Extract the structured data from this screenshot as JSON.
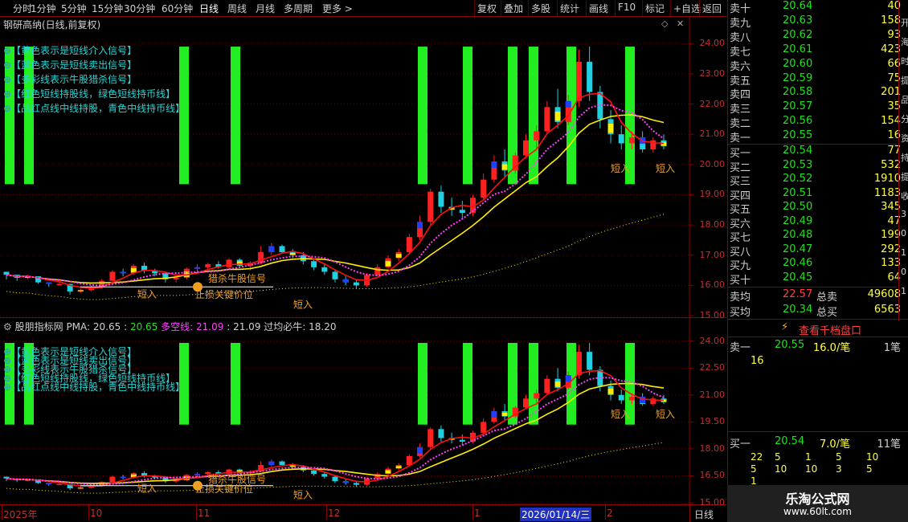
{
  "toolbar": {
    "periods": [
      "分时",
      "1分钟",
      "5分钟",
      "15分钟",
      "30分钟",
      "60分钟",
      "日线",
      "周线",
      "月线",
      "多周期",
      "更多 >"
    ],
    "active_period": "日线",
    "actions": [
      "复权",
      "叠加",
      "多股",
      "统计",
      "画线",
      "F10",
      "标记",
      "+自选",
      "返回"
    ]
  },
  "top_pane": {
    "title": "钢研高纳(日线,前复权)",
    "notes": [
      "【黄色表示是短线介入信号】",
      "【蓝色表示是短线卖出信号】",
      "【多彩线表示牛股猎杀信号】",
      "【红色短线持股线，绿色短线持币线】",
      "【品红点线中线持股，青色中线持币线】"
    ],
    "axis": [
      "24.00",
      "23.00",
      "22.00",
      "21.00",
      "20.00",
      "19.00",
      "18.00",
      "17.00",
      "16.00",
      "15.00"
    ],
    "labels": {
      "duanru1": "短入",
      "duanru2": "短入",
      "duanru3": "短入",
      "duanru4": "短入",
      "signal": "猎杀牛股信号",
      "stop": "止损关键价位"
    }
  },
  "bottom_pane": {
    "title": "股朋指标网",
    "pma_label": "PMA:",
    "pma_value": "20.65",
    "v2": "20.65",
    "duokong_label": "多空线:",
    "duokong_value": "21.09",
    "v4": "21.09",
    "niu_label": "过均必牛:",
    "niu_value": "18.20",
    "axis": [
      "24.00",
      "22.50",
      "21.00",
      "19.50",
      "18.00",
      "16.50",
      "15.00"
    ]
  },
  "xaxis": {
    "labels": [
      "2025年",
      "10",
      "11",
      "12",
      "1",
      "2026/01/14/三",
      "2"
    ],
    "mode": "日线"
  },
  "book": {
    "asks": [
      {
        "lab": "卖十",
        "price": "20.64",
        "vol": "40"
      },
      {
        "lab": "卖九",
        "price": "20.63",
        "vol": "158"
      },
      {
        "lab": "卖八",
        "price": "20.62",
        "vol": "93"
      },
      {
        "lab": "卖七",
        "price": "20.61",
        "vol": "423"
      },
      {
        "lab": "卖六",
        "price": "20.60",
        "vol": "66"
      },
      {
        "lab": "卖五",
        "price": "20.59",
        "vol": "75"
      },
      {
        "lab": "卖四",
        "price": "20.58",
        "vol": "201"
      },
      {
        "lab": "卖三",
        "price": "20.57",
        "vol": "35"
      },
      {
        "lab": "卖二",
        "price": "20.56",
        "vol": "154"
      },
      {
        "lab": "卖一",
        "price": "20.55",
        "vol": "16"
      }
    ],
    "bids": [
      {
        "lab": "买一",
        "price": "20.54",
        "vol": "77"
      },
      {
        "lab": "买二",
        "price": "20.53",
        "vol": "532"
      },
      {
        "lab": "买三",
        "price": "20.52",
        "vol": "1910"
      },
      {
        "lab": "买四",
        "price": "20.51",
        "vol": "1183"
      },
      {
        "lab": "买五",
        "price": "20.50",
        "vol": "345"
      },
      {
        "lab": "买六",
        "price": "20.49",
        "vol": "47"
      },
      {
        "lab": "买七",
        "price": "20.48",
        "vol": "199"
      },
      {
        "lab": "买八",
        "price": "20.47",
        "vol": "292"
      },
      {
        "lab": "买九",
        "price": "20.46",
        "vol": "133"
      },
      {
        "lab": "买十",
        "price": "20.45",
        "vol": "64"
      }
    ],
    "sell_avg_label": "卖均",
    "sell_avg": "22.57",
    "sell_total_label": "总卖",
    "sell_total": "49608",
    "buy_avg_label": "买均",
    "buy_avg": "20.34",
    "buy_total_label": "总买",
    "buy_total": "6563",
    "depth_button": "查看千档盘口",
    "s1_label": "卖一",
    "s1_price": "20.55",
    "s1_per": "16.0/笔",
    "s1_cnt": "1笔",
    "s1_q": "16",
    "b1_label": "买一",
    "b1_price": "20.54",
    "b1_per": "7.0/笔",
    "b1_cnt": "11笔",
    "b1_qrows": [
      [
        "22",
        "5",
        "1",
        "5",
        "10"
      ],
      [
        "5",
        "10",
        "10",
        "3",
        "5"
      ],
      [
        "1",
        "",
        "",
        "",
        ""
      ]
    ],
    "side_text": [
      "开",
      "海",
      "时",
      "提",
      "品",
      "分",
      "资",
      "持",
      "提",
      "收",
      "3",
      "0",
      "1",
      "0",
      "1"
    ]
  },
  "logo": {
    "name": "乐淘公式网",
    "url": "www.60lt.com"
  },
  "chart_data": {
    "type": "candlestick",
    "ylim_top": [
      15,
      24.3
    ],
    "ylim_bottom": [
      15,
      24.3
    ],
    "green_bars_x": [
      12,
      36,
      229,
      293,
      526,
      582,
      638,
      664,
      711,
      784
    ],
    "candles": [
      [
        16.45,
        16.45,
        16.2,
        16.35
      ],
      [
        16.35,
        16.3,
        16.15,
        16.25
      ],
      [
        16.25,
        16.35,
        16.2,
        16.3
      ],
      [
        16.3,
        16.2,
        16.05,
        16.1
      ],
      [
        16.1,
        16.05,
        15.95,
        16.05
      ],
      [
        16.05,
        16.1,
        16.0,
        16.05
      ],
      [
        16.05,
        15.95,
        15.7,
        15.8
      ],
      [
        15.8,
        15.9,
        15.75,
        15.85
      ],
      [
        15.85,
        16.0,
        15.8,
        15.95
      ],
      [
        15.95,
        16.2,
        15.9,
        16.15
      ],
      [
        16.15,
        16.5,
        16.1,
        16.45
      ],
      [
        16.45,
        16.55,
        16.3,
        16.4
      ],
      [
        16.4,
        16.7,
        16.35,
        16.65
      ],
      [
        16.65,
        16.75,
        16.4,
        16.5
      ],
      [
        16.5,
        16.55,
        16.3,
        16.4
      ],
      [
        16.4,
        16.35,
        16.1,
        16.2
      ],
      [
        16.2,
        16.3,
        16.1,
        16.25
      ],
      [
        16.25,
        16.6,
        16.2,
        16.55
      ],
      [
        16.55,
        16.7,
        16.45,
        16.6
      ],
      [
        16.6,
        16.75,
        16.5,
        16.7
      ],
      [
        16.7,
        16.8,
        16.55,
        16.6
      ],
      [
        16.6,
        16.9,
        16.55,
        16.85
      ],
      [
        16.85,
        16.9,
        16.6,
        16.65
      ],
      [
        16.65,
        16.8,
        16.5,
        16.75
      ],
      [
        16.75,
        17.3,
        16.7,
        17.1
      ],
      [
        17.1,
        17.4,
        17.0,
        17.3
      ],
      [
        17.3,
        17.35,
        17.05,
        17.1
      ],
      [
        17.1,
        17.2,
        16.9,
        17.0
      ],
      [
        17.0,
        17.1,
        16.7,
        16.8
      ],
      [
        16.8,
        16.85,
        16.5,
        16.6
      ],
      [
        16.6,
        16.7,
        16.35,
        16.45
      ],
      [
        16.45,
        16.5,
        16.1,
        16.2
      ],
      [
        16.2,
        16.3,
        16.0,
        16.1
      ],
      [
        16.1,
        16.2,
        15.9,
        16.0
      ],
      [
        16.0,
        16.4,
        15.95,
        16.35
      ],
      [
        16.35,
        16.7,
        16.3,
        16.6
      ],
      [
        16.6,
        17.0,
        16.55,
        16.9
      ],
      [
        16.9,
        17.2,
        16.8,
        17.1
      ],
      [
        17.1,
        17.7,
        17.05,
        17.6
      ],
      [
        17.6,
        18.3,
        17.5,
        18.1
      ],
      [
        18.1,
        19.2,
        18.0,
        19.1
      ],
      [
        19.1,
        19.3,
        18.4,
        18.6
      ],
      [
        18.6,
        18.9,
        18.3,
        18.5
      ],
      [
        18.5,
        18.8,
        18.2,
        18.4
      ],
      [
        18.4,
        19.0,
        18.3,
        18.9
      ],
      [
        18.9,
        19.7,
        18.8,
        19.5
      ],
      [
        19.5,
        20.3,
        19.4,
        20.1
      ],
      [
        20.1,
        20.5,
        19.6,
        19.8
      ],
      [
        19.8,
        20.4,
        19.7,
        20.3
      ],
      [
        20.3,
        21.0,
        20.2,
        20.8
      ],
      [
        20.8,
        21.3,
        20.5,
        21.1
      ],
      [
        21.1,
        22.1,
        21.0,
        21.9
      ],
      [
        21.9,
        22.5,
        21.2,
        21.4
      ],
      [
        21.4,
        22.3,
        21.3,
        22.1
      ],
      [
        22.1,
        23.8,
        21.9,
        23.4
      ],
      [
        23.4,
        23.9,
        22.1,
        22.4
      ],
      [
        22.4,
        22.6,
        21.2,
        21.5
      ],
      [
        21.5,
        21.8,
        20.7,
        21.0
      ],
      [
        21.0,
        21.3,
        20.5,
        20.7
      ],
      [
        20.7,
        21.1,
        20.5,
        20.9
      ],
      [
        20.9,
        21.1,
        20.4,
        20.5
      ],
      [
        20.5,
        20.9,
        20.4,
        20.8
      ],
      [
        20.8,
        21.0,
        20.5,
        20.6
      ]
    ]
  }
}
